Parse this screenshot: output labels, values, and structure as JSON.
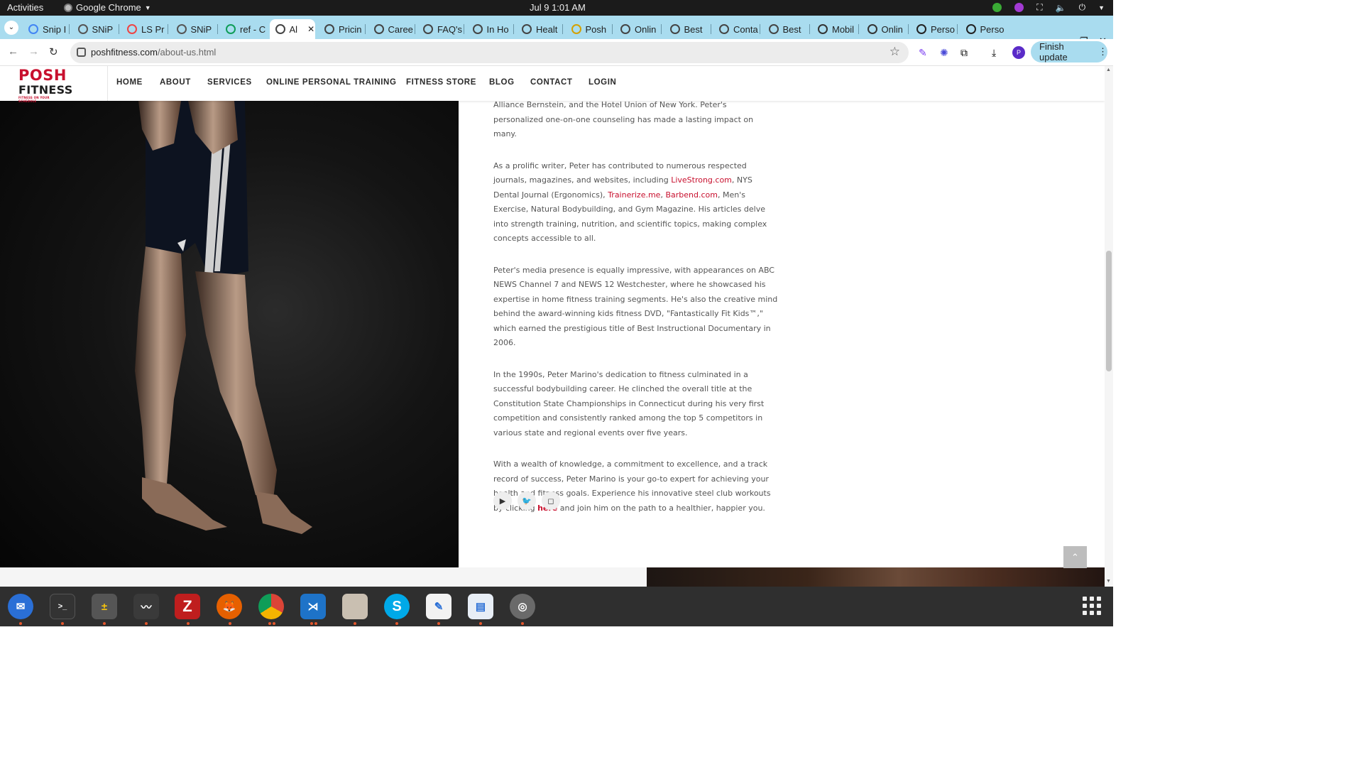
{
  "system": {
    "activities": "Activities",
    "app_name": "Google Chrome",
    "clock": "Jul 9  1:01 AM"
  },
  "browser": {
    "tabs": [
      {
        "title": "Snip I",
        "icon": "docs-icon"
      },
      {
        "title": "SNiP",
        "icon": "snip-icon"
      },
      {
        "title": "LS Pr",
        "icon": "ls-icon"
      },
      {
        "title": "SNiP",
        "icon": "snip-icon"
      },
      {
        "title": "ref - C",
        "icon": "sheets-icon"
      },
      {
        "title": "Al",
        "icon": "globe-icon",
        "active": true
      },
      {
        "title": "Pricin",
        "icon": "globe-icon"
      },
      {
        "title": "Caree",
        "icon": "globe-icon"
      },
      {
        "title": "FAQ's",
        "icon": "globe-icon"
      },
      {
        "title": "In Ho",
        "icon": "globe-icon"
      },
      {
        "title": "Healt",
        "icon": "globe-icon"
      },
      {
        "title": "Posh",
        "icon": "posh-icon"
      },
      {
        "title": "Onlin",
        "icon": "globe-icon"
      },
      {
        "title": "Best",
        "icon": "globe-icon"
      },
      {
        "title": "Conta",
        "icon": "globe-icon"
      },
      {
        "title": "Best",
        "icon": "globe-icon"
      },
      {
        "title": "Mobil",
        "icon": "arch-icon"
      },
      {
        "title": "Onlin",
        "icon": "arch-icon"
      },
      {
        "title": "Perso",
        "icon": "fs-icon"
      },
      {
        "title": "Perso",
        "icon": "fs-icon"
      }
    ],
    "new_tab": "+",
    "url_domain": "poshfitness.com",
    "url_path": "/about-us.html",
    "finish_update": "Finish update",
    "profile_initial": "P"
  },
  "site": {
    "logo": {
      "line1": "POSH",
      "line2": "FITNESS",
      "tagline": "FITNESS ON YOUR SCHEDULE"
    },
    "nav": [
      "HOME",
      "ABOUT",
      "SERVICES",
      "ONLINE PERSONAL TRAINING",
      "FITNESS STORE",
      "BLOG",
      "CONTACT",
      "LOGIN"
    ],
    "paragraphs": {
      "p1": "Alliance Bernstein, and the Hotel Union of New York. Peter's personalized one-on-one counseling has made a lasting impact on many.",
      "p2_a": "As a prolific writer, Peter has contributed to numerous respected journals, magazines, and websites, including ",
      "p2_link1": "LiveStrong.com",
      "p2_b": ", NYS Dental Journal (Ergonomics), ",
      "p2_link2": "Trainerize.me",
      "p2_c": ", ",
      "p2_link3": "Barbend.com",
      "p2_d": ", Men's Exercise, Natural Bodybuilding, and Gym Magazine. His articles delve into strength training, nutrition, and scientific topics, making complex concepts accessible to all.",
      "p3": "Peter's media presence is equally impressive, with appearances on ABC NEWS Channel 7 and NEWS 12 Westchester, where he showcased his expertise in home fitness training segments. He's also the creative mind behind the award-winning kids fitness DVD, \"Fantastically Fit Kids™,\" which earned the prestigious title of Best Instructional Documentary in 2006.",
      "p4": "In the 1990s, Peter Marino's dedication to fitness culminated in a successful bodybuilding career. He clinched the overall title at the Constitution State Championships in Connecticut during his very first competition and consistently ranked among the top 5 competitors in various state and regional events over five years.",
      "p5_a": "With a wealth of knowledge, a commitment to excellence, and a track record of success, Peter Marino is your go-to expert for achieving your health and fitness goals. Experience his innovative steel club workouts by clicking ",
      "p5_link": "here",
      "p5_b": " and join him on the path to a healthier, happier you."
    },
    "social_icons": [
      "youtube-icon",
      "twitter-icon",
      "instagram-icon"
    ],
    "brand_color": "#c8102e"
  },
  "dock": {
    "apps": [
      "thunderbird",
      "terminal",
      "calculator",
      "system-monitor",
      "filezilla",
      "firefox",
      "chrome",
      "vscode",
      "files",
      "skype",
      "text-editor",
      "document-viewer",
      "disks"
    ]
  }
}
